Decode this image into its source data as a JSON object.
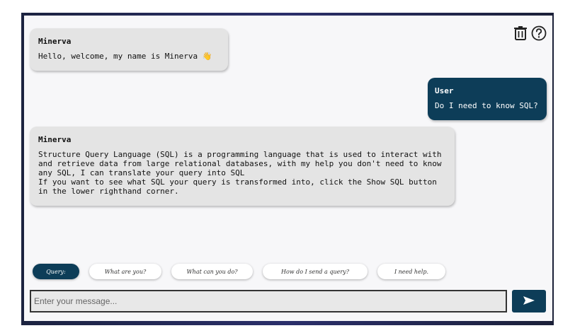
{
  "header": {
    "icons": [
      "trash-icon",
      "help-icon"
    ]
  },
  "messages": [
    {
      "role": "bot",
      "sender": "Minerva",
      "text": "Hello, welcome, my name is Minerva 👋"
    },
    {
      "role": "user",
      "sender": "User",
      "text": "Do I need to know SQL?"
    },
    {
      "role": "bot",
      "sender": "Minerva",
      "text": "Structure Query Language (SQL) is a programming language that is used to interact with\nand retrieve data from large relational databases, with my help you don't need to know\nany SQL, I can translate your query into SQL\nIf you want to see what SQL your query is transformed into, click the Show SQL button\nin the lower righthand corner."
    }
  ],
  "suggestions": {
    "items": [
      {
        "label": "Query:",
        "active": true
      },
      {
        "label": "What are you?",
        "active": false
      },
      {
        "label": "What can you do?",
        "active": false
      },
      {
        "label": "How do I send a query?",
        "active": false
      },
      {
        "label": "I need help.",
        "active": false
      }
    ]
  },
  "input": {
    "placeholder": "Enter your message...",
    "value": ""
  },
  "send": {
    "icon": "send-arrow-icon"
  },
  "colors": {
    "user_bubble": "#0d3d58",
    "bot_bubble": "#e4e4e4",
    "panel_bg": "#f7f7f9"
  }
}
